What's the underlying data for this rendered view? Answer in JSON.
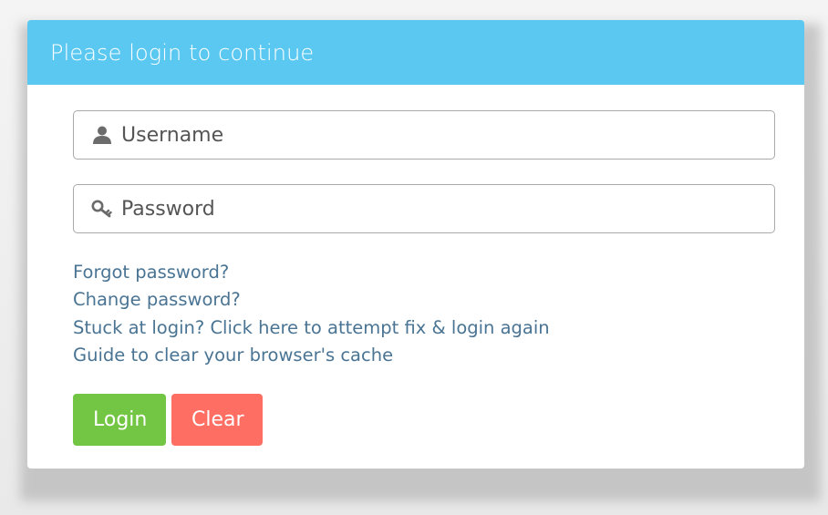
{
  "header": {
    "title": "Please login to continue"
  },
  "form": {
    "username": {
      "placeholder": "Username",
      "icon": "user-icon",
      "value": ""
    },
    "password": {
      "placeholder": "Password",
      "icon": "key-icon",
      "value": ""
    }
  },
  "links": {
    "forgot": "Forgot password?",
    "change": "Change password?",
    "stuck": "Stuck at login? Click here to attempt fix & login again",
    "cache_guide": "Guide to clear your browser's cache"
  },
  "buttons": {
    "login": "Login",
    "clear": "Clear"
  },
  "colors": {
    "header_bg": "#5bc8f1",
    "login_bg": "#73c644",
    "clear_bg": "#ff6e63",
    "link": "#4a7493"
  }
}
